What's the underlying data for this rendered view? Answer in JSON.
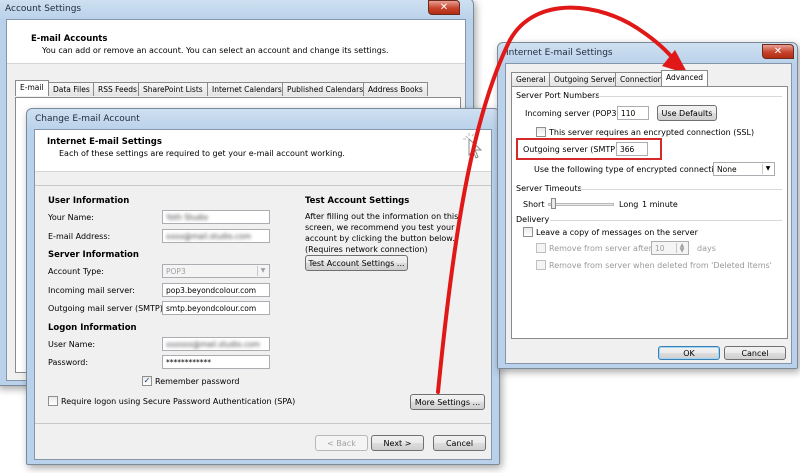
{
  "account_settings": {
    "title": "Account Settings",
    "heading": "E-mail Accounts",
    "subtext": "You can add or remove an account. You can select an account and change its settings.",
    "tabs": [
      "E-mail",
      "Data Files",
      "RSS Feeds",
      "SharePoint Lists",
      "Internet Calendars",
      "Published Calendars",
      "Address Books"
    ],
    "close_glyph": "✕"
  },
  "change_account": {
    "title": "Change E-mail Account",
    "heading": "Internet E-mail Settings",
    "subtext": "Each of these settings are required to get your e-mail account working.",
    "user_info": {
      "heading": "User Information",
      "your_name_label": "Your Name:",
      "your_name_value": "Yoth Studio",
      "email_label": "E-mail Address:",
      "email_value": "xxxx@mail.studio.com"
    },
    "server_info": {
      "heading": "Server Information",
      "account_type_label": "Account Type:",
      "account_type_value": "POP3",
      "incoming_label": "Incoming mail server:",
      "incoming_value": "pop3.beyondcolour.com",
      "outgoing_label": "Outgoing mail server (SMTP):",
      "outgoing_value": "smtp.beyondcolour.com"
    },
    "logon_info": {
      "heading": "Logon Information",
      "username_label": "User Name:",
      "username_value": "xxxxxx@mail.studio.com",
      "password_label": "Password:",
      "password_value": "************",
      "remember_label": "Remember password",
      "spa_label": "Require logon using Secure Password Authentication (SPA)"
    },
    "test": {
      "heading": "Test Account Settings",
      "text": "After filling out the information on this screen, we recommend you test your account by clicking the button below. (Requires network connection)",
      "button": "Test Account Settings ..."
    },
    "more_settings_button": "More Settings ...",
    "back_button": "< Back",
    "next_button": "Next >",
    "cancel_button": "Cancel"
  },
  "internet_settings": {
    "title": "Internet E-mail Settings",
    "close_glyph": "✕",
    "tabs": [
      "General",
      "Outgoing Server",
      "Connection",
      "Advanced"
    ],
    "active_tab": "Advanced",
    "server_ports_heading": "Server Port Numbers",
    "incoming_label": "Incoming server (POP3):",
    "incoming_value": "110",
    "use_defaults_button": "Use Defaults",
    "ssl_label": "This server requires an encrypted connection (SSL)",
    "outgoing_label": "Outgoing server (SMTP):",
    "outgoing_value": "366",
    "encryption_label": "Use the following type of encrypted connection:",
    "encryption_value": "None",
    "timeouts_heading": "Server Timeouts",
    "short_label": "Short",
    "long_label": "Long",
    "timeout_value": "1 minute",
    "delivery_heading": "Delivery",
    "leave_copy_label": "Leave a copy of messages on the server",
    "remove_after_label": "Remove from server after",
    "remove_after_value": "10",
    "days_label": "days",
    "remove_deleted_label": "Remove from server when deleted from 'Deleted Items'",
    "ok_button": "OK",
    "cancel_button": "Cancel"
  },
  "colors": {
    "highlight_box": "#d42a2a",
    "arrow": "#e01818"
  }
}
